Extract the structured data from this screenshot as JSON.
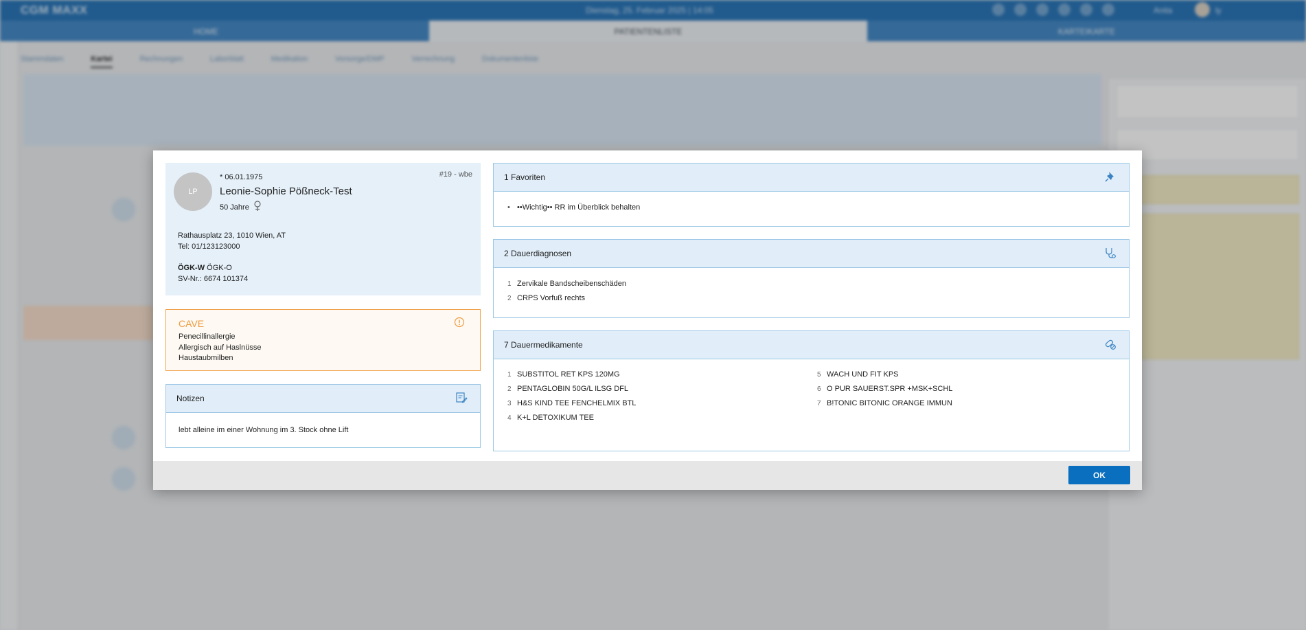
{
  "app": {
    "name": "CGM MAXX",
    "datetime": "Dienstag, 25. Februar 2025 | 14:05",
    "user": "Anita",
    "user_initials": "ly",
    "nav": [
      "HOME",
      "PATIENTENLISTE",
      "KARTEIKARTE"
    ],
    "subtabs": [
      "Stammdaten",
      "Kartei",
      "Rechnungen",
      "Laborblatt",
      "Medikation",
      "Vorsorge/DMP",
      "Verrechnung",
      "Dokumentenliste"
    ]
  },
  "patient": {
    "initials": "LP",
    "dob": "* 06.01.1975",
    "record_id": "#19 - wbe",
    "name": "Leonie-Sophie Pößneck-Test",
    "age": "50 Jahre",
    "address": "Rathausplatz 23, 1010 Wien, AT",
    "phone": "Tel: 01/123123000",
    "insurance_code": "ÖGK-W",
    "insurance_name": "ÖGK-O",
    "sv_nr": "SV-Nr.: 6674 101374"
  },
  "cave": {
    "title": "CAVE",
    "items": [
      "Penecillinallergie",
      "Allergisch auf Haslnüsse",
      "Haustaubmilben"
    ]
  },
  "notes": {
    "title": "Notizen",
    "text": "lebt alleine im einer Wohnung im 3. Stock ohne Lift"
  },
  "favorites": {
    "title": "1 Favoriten",
    "items": [
      "••Wichtig•• RR im Überblick behalten"
    ]
  },
  "diagnoses": {
    "title": "2 Dauerdiagnosen",
    "items": [
      {
        "num": "1",
        "text": "Zervikale Bandscheibenschäden"
      },
      {
        "num": "2",
        "text": "CRPS Vorfuß rechts"
      }
    ]
  },
  "medications": {
    "title": "7 Dauermedikamente",
    "items": [
      {
        "num": "1",
        "text": "SUBSTITOL RET KPS 120MG"
      },
      {
        "num": "2",
        "text": "PENTAGLOBIN 50G/L ILSG DFL"
      },
      {
        "num": "3",
        "text": "H&S KIND TEE FENCHELMIX BTL"
      },
      {
        "num": "4",
        "text": "K+L DETOXIKUM TEE"
      },
      {
        "num": "5",
        "text": "WACH UND FIT KPS"
      },
      {
        "num": "6",
        "text": "O PUR SAUERST.SPR +MSK+SCHL"
      },
      {
        "num": "7",
        "text": "B!TONIC BITONIC ORANGE IMMUN"
      }
    ]
  },
  "buttons": {
    "ok": "OK"
  },
  "colors": {
    "accent": "#0a6fbf",
    "cave": "#ef9a3c",
    "box_border": "#9cc7e6"
  }
}
